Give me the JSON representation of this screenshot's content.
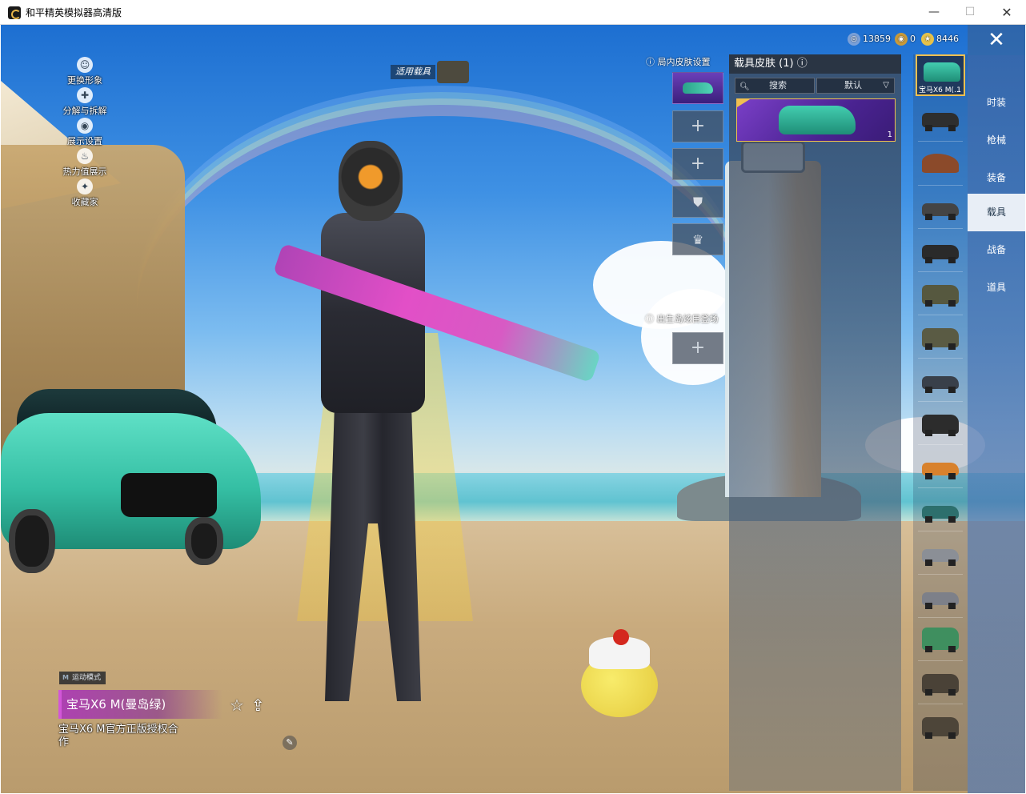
{
  "window": {
    "title": "和平精英模拟器高清版",
    "min_label": "—",
    "max_label": "☐",
    "close_label": "✕"
  },
  "side_menu": [
    {
      "label": "更换形象",
      "icon": "person-icon"
    },
    {
      "label": "分解与拆解",
      "icon": "puzzle-icon"
    },
    {
      "label": "展示设置",
      "icon": "eye-icon"
    },
    {
      "label": "热力值展示",
      "icon": "fire-icon"
    },
    {
      "label": "收藏家",
      "icon": "badge-icon"
    }
  ],
  "apply_vehicle_label": "适用载具",
  "currency": [
    {
      "value": "13859",
      "icon": "coupon-icon",
      "color": "#7aa0d8"
    },
    {
      "value": "0",
      "icon": "uc-icon",
      "color": "#c89a3a"
    },
    {
      "value": "8446",
      "icon": "coin-icon",
      "color": "#e6c24a"
    }
  ],
  "close_label": "✕",
  "ingame_skin": {
    "title": "局内皮肤设置",
    "add_label": "+"
  },
  "birth_island": {
    "title": "出生岛炫目登场",
    "add_label": "+"
  },
  "skin_panel": {
    "title": "载具皮肤 (1)",
    "search_label": "搜索",
    "sort_label": "默认",
    "selected_count": "1"
  },
  "vehicle_list": {
    "selected_name": "宝马X6 M(...",
    "selected_qty": "1"
  },
  "categories": [
    {
      "label": "时装",
      "active": false
    },
    {
      "label": "枪械",
      "active": false
    },
    {
      "label": "装备",
      "active": false
    },
    {
      "label": "载具",
      "active": true
    },
    {
      "label": "战备",
      "active": false
    },
    {
      "label": "道具",
      "active": false
    }
  ],
  "vehicle_info": {
    "mode": "运动模式",
    "name": "宝马X6 M(曼岛绿)",
    "description": "宝马X6 M官方正版授权合作"
  },
  "colors": {
    "accent_gold": "#f0c050",
    "skin_purple": "#7a3fc7",
    "car_green": "#35bfa4"
  }
}
